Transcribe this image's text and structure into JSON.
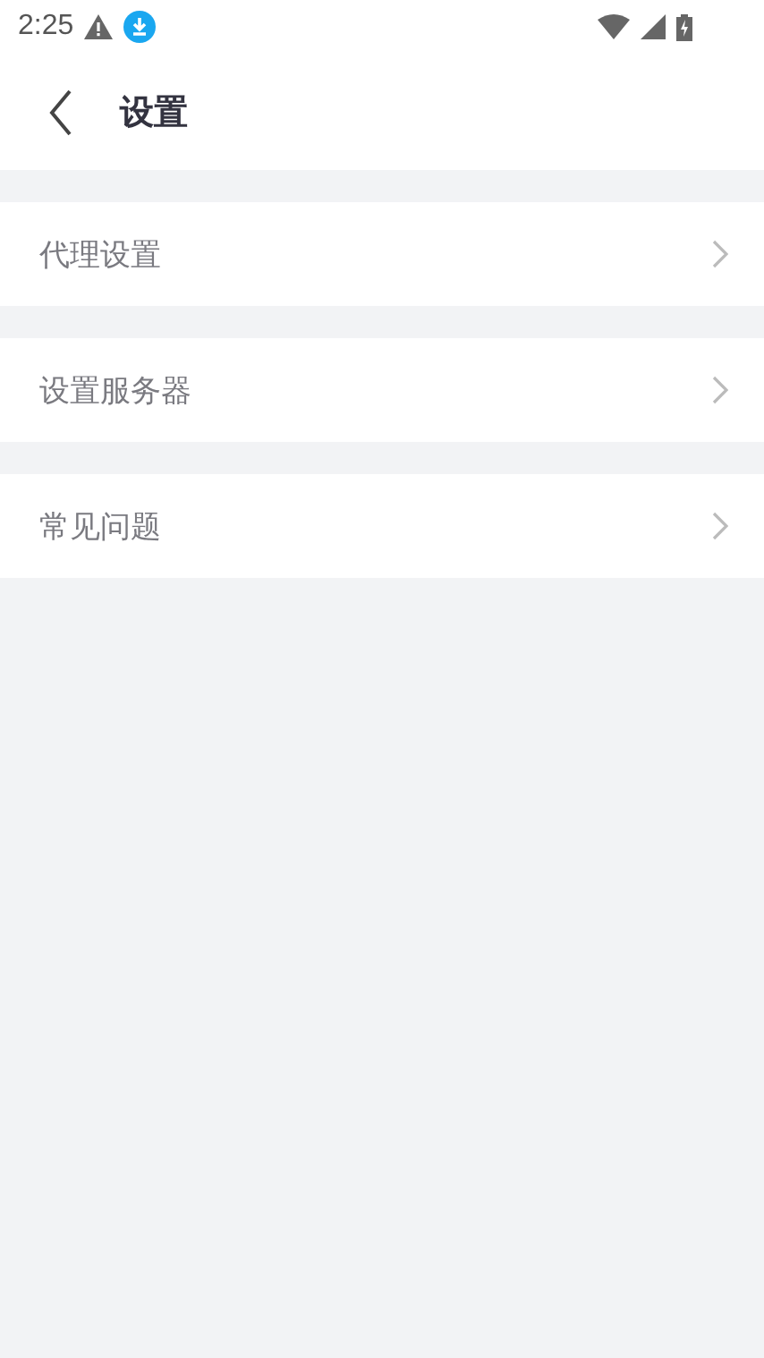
{
  "status_bar": {
    "time": "2:25"
  },
  "header": {
    "title": "设置"
  },
  "menu": [
    {
      "label": "代理设置"
    },
    {
      "label": "设置服务器"
    },
    {
      "label": "常见问题"
    }
  ]
}
